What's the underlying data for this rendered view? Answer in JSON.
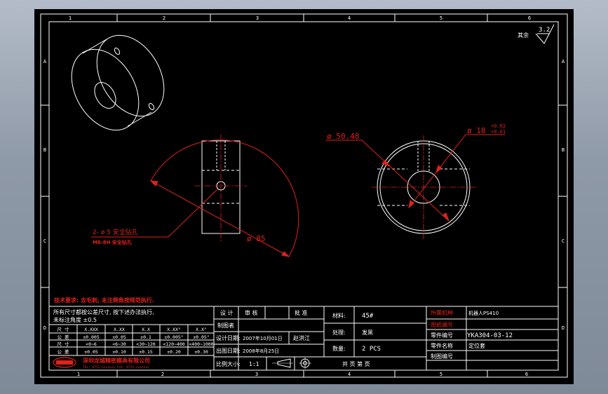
{
  "drawing": {
    "columns_top": [
      "1",
      "2",
      "3",
      "4",
      "5",
      "6"
    ],
    "columns_bottom": [
      "1",
      "2",
      "3",
      "4",
      "5",
      "6"
    ],
    "rows_left": [
      "A",
      "B",
      "C",
      "D"
    ],
    "rows_right": [
      "A",
      "B",
      "C",
      "D"
    ],
    "roughness": "3.2",
    "roughness_label": "其余",
    "dims": {
      "d_outer": "ø 50.48",
      "d_bore": "ø 18",
      "tol_upper": "+0.02",
      "tol_lower": "+0.01",
      "d_85": "ø 85",
      "hole_note1": "2- ø 5 安全钻孔",
      "hole_note2": "M6-8H 安全钻孔"
    },
    "notes": {
      "tech_req": "技术要求: 去毛刺, 未注倒角按规范执行.",
      "tol_title1": "所有尺寸都按公差尺寸, 按下述办法执行,",
      "tol_title2": "未标注角度 ±0.5"
    },
    "tolerance_table": {
      "headers": [
        "尺 寸",
        "X.XXX",
        "X.XX",
        "X.X",
        "X.XX°",
        "X.X°"
      ],
      "rows": [
        [
          "公 差",
          "±0.005",
          "±0.05",
          "±0.1",
          "±0.005°",
          "±0.05°"
        ],
        [
          "尺 寸",
          "<0~6",
          "<6~30",
          "<30~120",
          "<120~400",
          "<400~1000"
        ],
        [
          "公 差",
          "±0.05",
          "±0.10",
          "±0.15",
          "±0.20",
          "±0.30"
        ]
      ]
    },
    "title_block": {
      "design": "设 计",
      "check": "审 核",
      "approve": "批 准",
      "drawer": "制图者",
      "design_date_label": "设计日期:",
      "design_date": "2007年10月01日",
      "designer": "赵洪江",
      "out_date_label": "出图日期:",
      "out_date": "2008年8月25日",
      "scale_label": "比例大小:",
      "scale": "1:1",
      "company": "深圳龙城精密模具有限公司",
      "company_sub": "TEL: 0755-xxxxxxx  FAX: 0755-xxxxxxx",
      "material_label": "材料:",
      "material": "45#",
      "finish_label": "处理:",
      "finish": "发黑",
      "qty_label": "数量:",
      "qty": "2 PCS",
      "sheet": "共 页  第 页",
      "machine_label": "所属机种",
      "machine": "机器人PS410",
      "drawing_no_label": "图纸编号",
      "part_no_label": "零件编号",
      "part_no": "YKA304-03-12",
      "part_name_label": "零件名称",
      "part_name": "定位套",
      "drafter_label": "制图编号"
    }
  }
}
